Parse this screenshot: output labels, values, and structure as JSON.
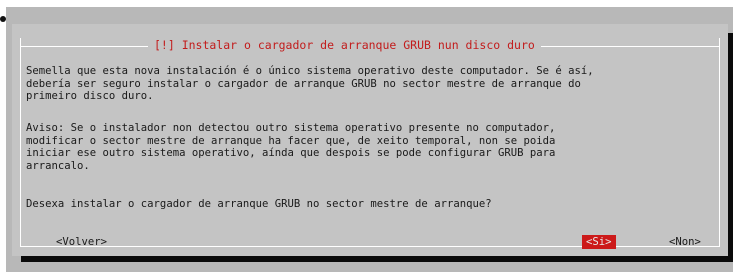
{
  "dialog": {
    "title": "[!] Instalar o cargador de arranque GRUB nun disco duro",
    "paragraph1": "Semella que esta nova instalación é o único sistema operativo deste computador. Se é así,\ndebería ser seguro instalar o cargador de arranque GRUB no sector mestre de arranque do\nprimeiro disco duro.",
    "paragraph2": "Aviso: Se o instalador non detectou outro sistema operativo presente no computador,\nmodificar o sector mestre de arranque ha facer que, de xeito temporal, non se poida\niniciar ese outro sistema operativo, aínda que despois se pode configurar GRUB para\narrancalo.",
    "question": "Desexa instalar o cargador de arranque GRUB no sector mestre de arranque?",
    "buttons": {
      "back": "<Volver>",
      "yes": "<Si>",
      "no": "<Non>"
    }
  },
  "colors": {
    "background": "#b8b8b8",
    "dialog": "#c4c4c4",
    "title_text": "#c21c1c",
    "selected_button": "#cc1a1a",
    "shadow": "#0a0a0a"
  }
}
